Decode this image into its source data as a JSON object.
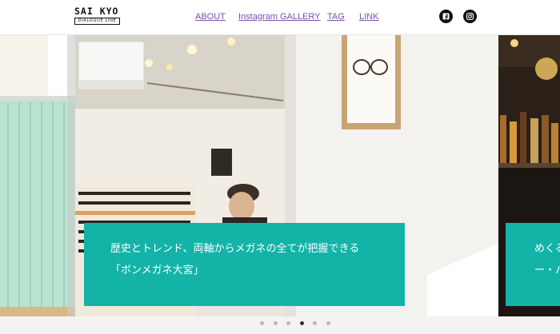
{
  "brand": {
    "logo_top": "SAI KYO",
    "logo_bottom": "DIALOGUE LINE"
  },
  "nav": {
    "items": [
      {
        "label": "ABOUT"
      },
      {
        "label": "Instagram GALLERY"
      },
      {
        "label": "TAG"
      },
      {
        "label": "LINK"
      }
    ]
  },
  "social": [
    {
      "icon": "facebook-icon"
    },
    {
      "icon": "instagram-icon"
    }
  ],
  "slider": {
    "current": {
      "caption_line1": "歴史とトレンド、両軸からメガネの全てが把握できる",
      "caption_line2": "「ボンメガネ大宮」"
    },
    "next": {
      "caption_line1": "めくる",
      "caption_line2": "ー・ハ"
    },
    "caption_color": "#14b3a8",
    "dot_count": 6,
    "active_dot": 4
  }
}
